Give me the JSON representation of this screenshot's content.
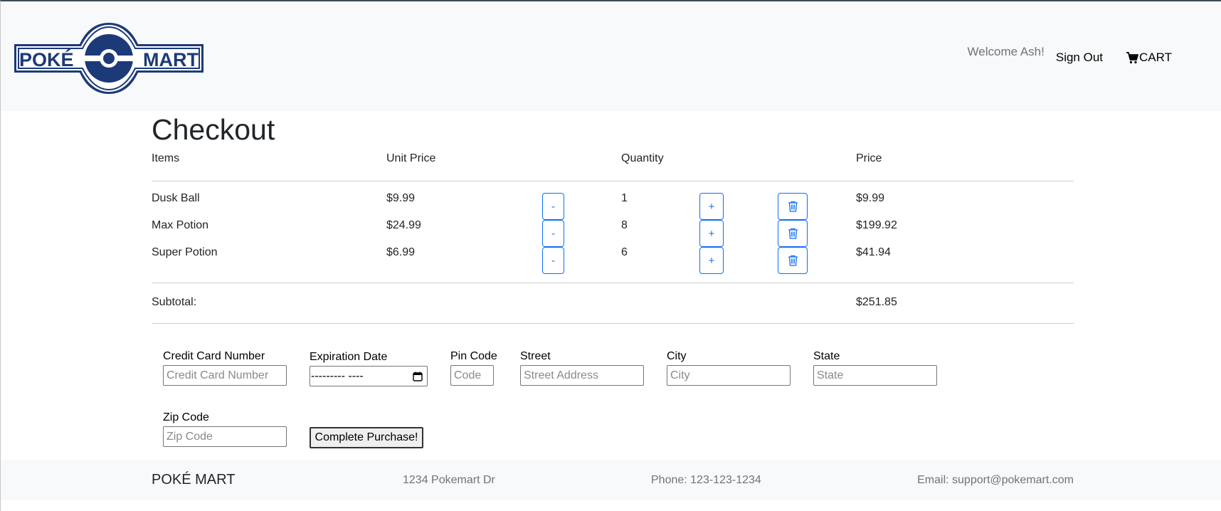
{
  "header": {
    "brand_left": "POKÉ",
    "brand_right": "MART",
    "welcome": "Welcome Ash!",
    "sign_out": "Sign Out",
    "cart": "CART"
  },
  "checkout": {
    "title": "Checkout",
    "columns": {
      "items": "Items",
      "unit_price": "Unit Price",
      "quantity": "Quantity",
      "price": "Price"
    },
    "rows": [
      {
        "name": "Dusk Ball",
        "unit_price": "$9.99",
        "quantity": "1",
        "price": "$9.99"
      },
      {
        "name": "Max Potion",
        "unit_price": "$24.99",
        "quantity": "8",
        "price": "$199.92"
      },
      {
        "name": "Super Potion",
        "unit_price": "$6.99",
        "quantity": "6",
        "price": "$41.94"
      }
    ],
    "decrement_label": "-",
    "increment_label": "+",
    "subtotal_label": "Subtotal:",
    "subtotal_value": "$251.85"
  },
  "form": {
    "card_label": "Credit Card Number",
    "card_placeholder": "Credit Card Number",
    "exp_label": "Expiration Date",
    "exp_value": "--------- ----",
    "pin_label": "Pin Code",
    "pin_placeholder": "Code",
    "street_label": "Street",
    "street_placeholder": "Street Address",
    "city_label": "City",
    "city_placeholder": "City",
    "state_label": "State",
    "state_placeholder": "State",
    "zip_label": "Zip Code",
    "zip_placeholder": "Zip Code",
    "submit": "Complete Purchase!"
  },
  "footer": {
    "brand": "POKÉ MART",
    "address": "1234 Pokemart Dr",
    "phone": "Phone: 123-123-1234",
    "email": "Email: support@pokemart.com"
  },
  "colors": {
    "brand_navy": "#1d3a78",
    "accent": "#0d6efd",
    "header_bg": "#f8f9fa"
  },
  "icons": [
    "pokeball-logo",
    "cart-icon",
    "trash-icon",
    "calendar-icon"
  ]
}
